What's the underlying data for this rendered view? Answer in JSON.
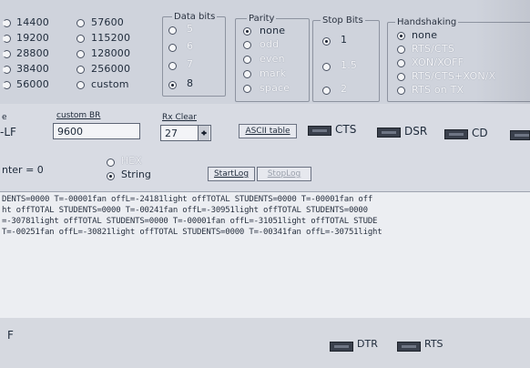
{
  "baud": {
    "col1": [
      "14400",
      "19200",
      "28800",
      "38400",
      "56000"
    ],
    "col2": [
      "57600",
      "115200",
      "128000",
      "256000",
      "custom"
    ]
  },
  "data_bits": {
    "title": "Data bits",
    "options": [
      "5",
      "6",
      "7",
      "8"
    ],
    "selected": "8"
  },
  "parity": {
    "title": "Parity",
    "options": [
      "none",
      "odd",
      "even",
      "mark",
      "space"
    ],
    "selected": "none"
  },
  "stop_bits": {
    "title": "Stop Bits",
    "options": [
      "1",
      "1.5",
      "2"
    ],
    "selected": "1"
  },
  "handshaking": {
    "title": "Handshaking",
    "options": [
      "none",
      "RTS/CTS",
      "XON/XOFF",
      "RTS/CTS+XON/X",
      "RTS on TX"
    ],
    "selected": "none"
  },
  "settings_row": {
    "left_label_top": "e",
    "left_label": "-LF",
    "custom_br_label": "custom BR",
    "custom_br_value": "9600",
    "rx_clear_label": "Rx Clear",
    "rx_clear_value": "27",
    "ascii_button": "ASCII table",
    "leds": [
      "CTS",
      "DSR",
      "CD"
    ]
  },
  "receive": {
    "counter": "nter = 0",
    "hex_label": "HEX",
    "string_label": "String",
    "selected": "String",
    "startlog": "StartLog",
    "stoplog": "StopLog"
  },
  "terminal_lines": [
    "DENTS=0000 T=-00001fan offL=-24181light offTOTAL STUDENTS=0000 T=-00001fan off",
    "ht offTOTAL STUDENTS=0000 T=-00241fan offL=-30951light offTOTAL STUDENTS=0000",
    "=-30781light offTOTAL STUDENTS=0000 T=-00001fan offL=-31051light offTOTAL STUDE",
    "T=-00251fan offL=-30821light offTOTAL STUDENTS=0000 T=-00341fan offL=-30751light"
  ],
  "bottom": {
    "left_label": "F",
    "leds": [
      "DTR",
      "RTS"
    ]
  }
}
